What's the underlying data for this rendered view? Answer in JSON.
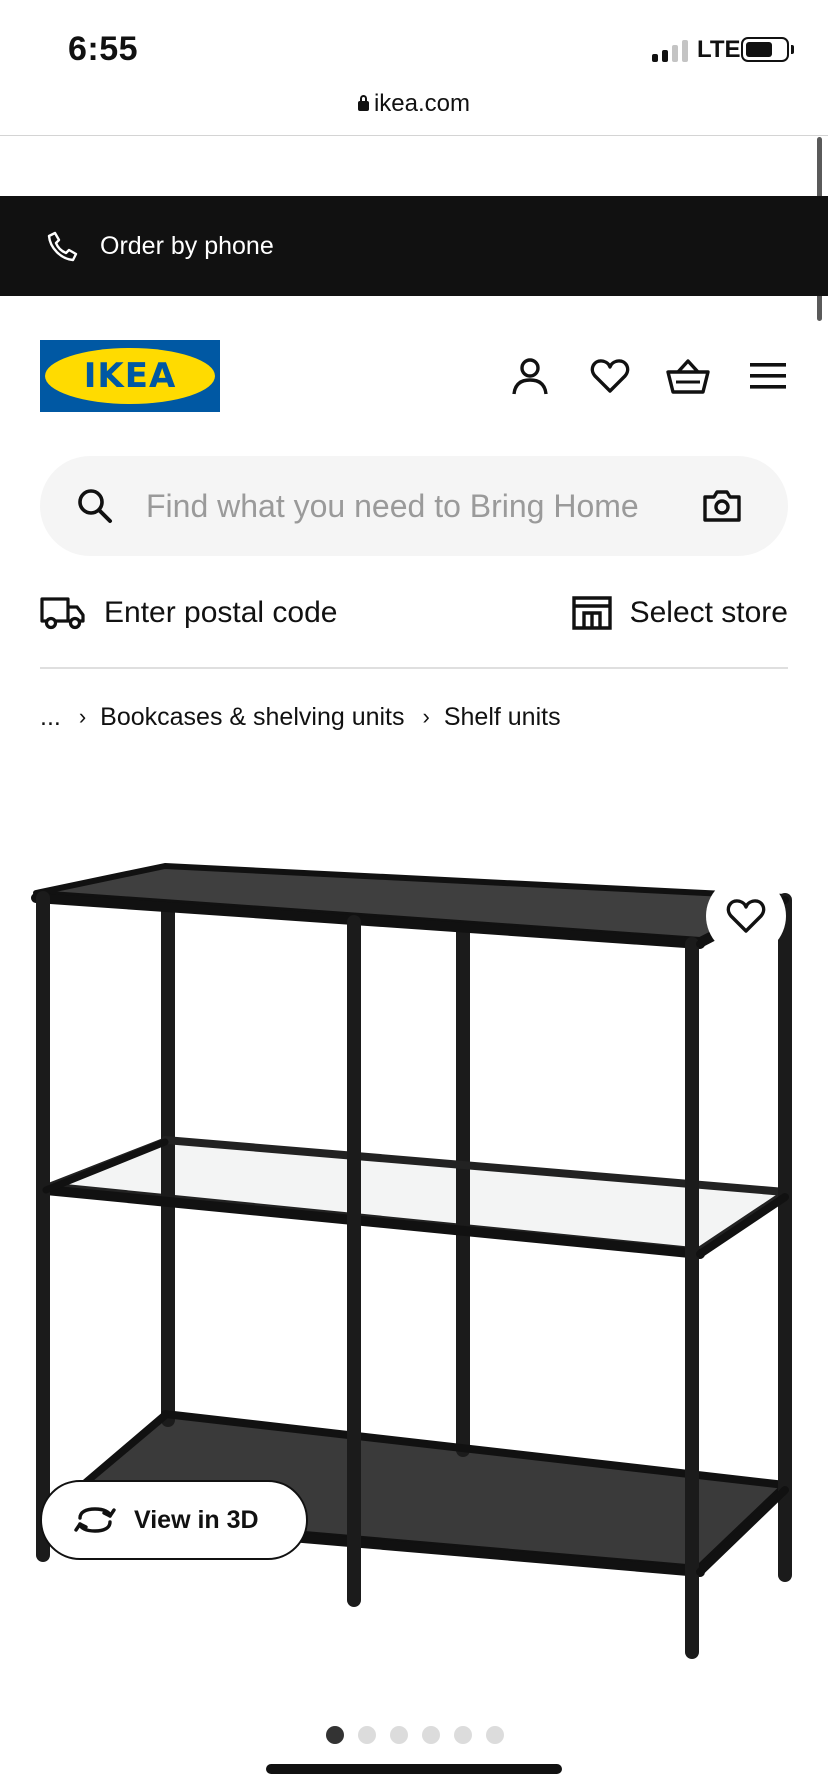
{
  "status_bar": {
    "time": "6:55",
    "network": "LTE"
  },
  "browser": {
    "url": "ikea.com"
  },
  "banner": {
    "order_by_phone": "Order by phone"
  },
  "header": {
    "logo_text": "IKEA",
    "icons": [
      "user-icon",
      "heart-icon",
      "basket-icon",
      "menu-icon"
    ]
  },
  "search": {
    "placeholder": "Find what you need to Bring Home"
  },
  "delivery": {
    "postal_label": "Enter postal code",
    "store_label": "Select store"
  },
  "breadcrumb": {
    "ellipsis": "...",
    "items": [
      "Bookcases & shelving units",
      "Shelf units"
    ]
  },
  "product": {
    "view_3d_label": "View in 3D"
  },
  "carousel": {
    "total": 6,
    "active": 1
  },
  "colors": {
    "banner_bg": "#111111",
    "logo_blue": "#0058a3",
    "logo_yellow": "#ffdb00",
    "search_bg": "#f5f5f5"
  }
}
